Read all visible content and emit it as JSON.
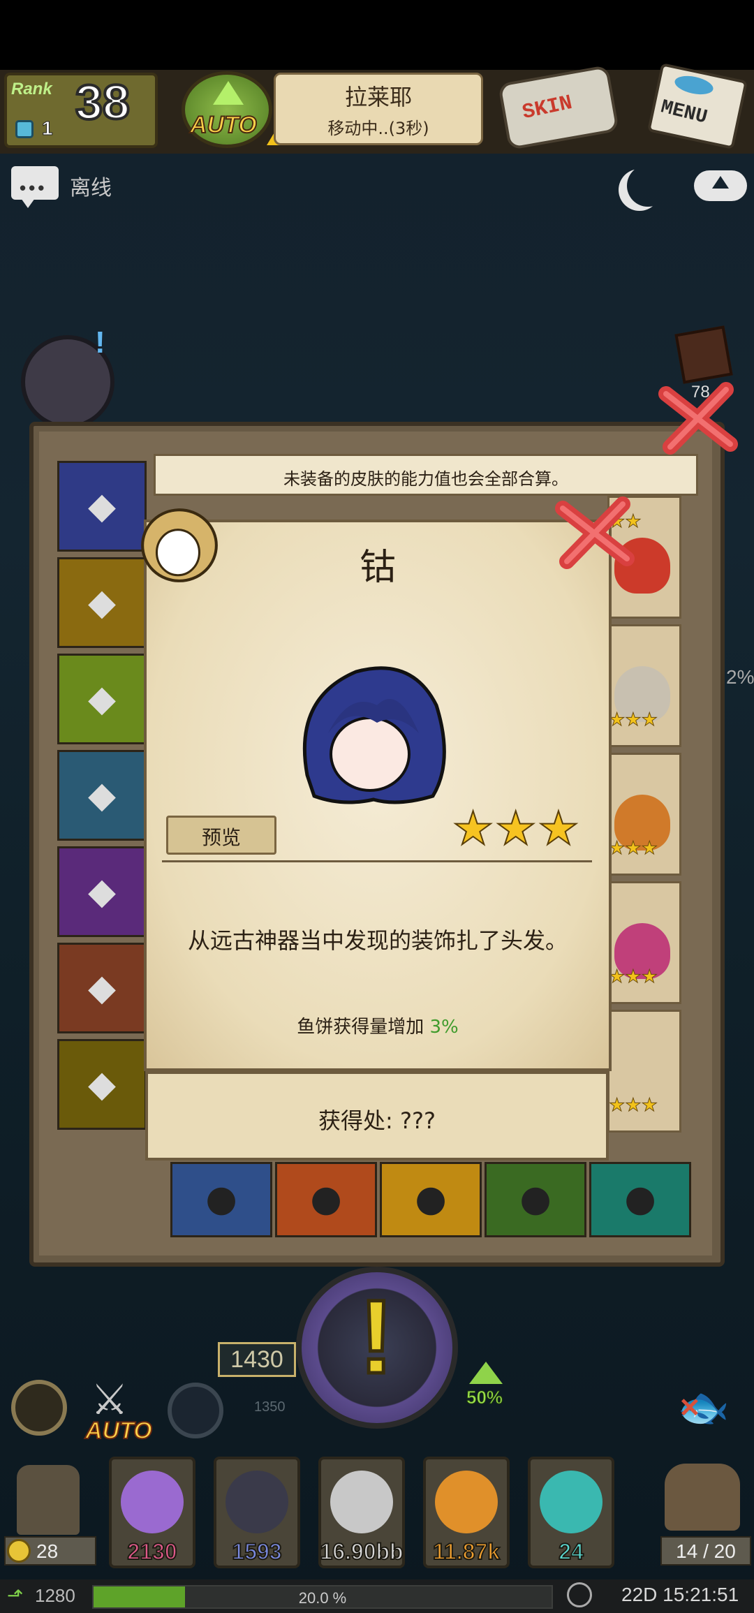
{
  "header": {
    "rank_label": "Rank",
    "rank_value": "38",
    "gems": "1",
    "auto_label": "AUTO",
    "location_name": "拉莱耶",
    "location_status": "移动中..(3秒)",
    "skin_label": "SKIN",
    "menu_label": "MENU"
  },
  "chat": {
    "dots": "•••",
    "status": "离线"
  },
  "side": {
    "badge": "78",
    "percent": "2%"
  },
  "panel": {
    "hint": "未装备的皮肤的能力值也会全部合算。",
    "tabs": [
      {
        "icon": "pistol-icon",
        "color": "#2f3a86"
      },
      {
        "icon": "top-hat-icon",
        "color": "#8a6a10"
      },
      {
        "icon": "hair-icon",
        "color": "#6a8a1c"
      },
      {
        "icon": "clothes-icon",
        "color": "#2a5a74"
      },
      {
        "icon": "ship-icon",
        "color": "#5a2a7a"
      },
      {
        "icon": "bag-icon",
        "color": "#7a3a22"
      },
      {
        "icon": "lantern-icon",
        "color": "#6a5a0a"
      }
    ],
    "slots": [
      {
        "icon": "cat-icon",
        "color": "#2f4f8a"
      },
      {
        "icon": "harpoon-icon",
        "color": "#b04a1c"
      },
      {
        "icon": "cannon-icon",
        "color": "#c08a12"
      },
      {
        "icon": "binoculars-icon",
        "color": "#3a6a22"
      },
      {
        "icon": "crystal-icon",
        "color": "#1a7a6a"
      }
    ],
    "right_cards": [
      {
        "stars": "★★",
        "hair_color": "#cc3a2a"
      },
      {
        "stars": "★★★",
        "hair_color": "#c8c0b0"
      },
      {
        "stars": "★★★",
        "hair_color": "#d07a2a"
      },
      {
        "stars": "★★★",
        "hair_color": "#c0407a"
      },
      {
        "stars": "★★★",
        "hair_color": ""
      }
    ]
  },
  "popup": {
    "title": "钴",
    "preview_label": "预览",
    "stars": "★★★",
    "description": "从远古神器当中发现的装饰扎了头发。",
    "bonus_label": "鱼饼获得量增加",
    "bonus_value": "3%",
    "source": "获得处:  ???",
    "hair_color": "#2e3a8e"
  },
  "hud": {
    "score": "1430",
    "small_score": "1350",
    "boost": "50%",
    "auto_label": "AUTO"
  },
  "resources": [
    {
      "icon": "pearl-icon",
      "value": "2130",
      "color": "#e05a8a",
      "ico_color": "#9a6ad0"
    },
    {
      "icon": "dark-gem-icon",
      "value": "1593",
      "color": "#7a8ae0",
      "ico_color": "#3a3a4a"
    },
    {
      "icon": "shell-icon",
      "value": "16.90bb",
      "color": "#d8d8d8",
      "ico_color": "#c8c8c8"
    },
    {
      "icon": "amber-icon",
      "value": "11.87k",
      "color": "#f0a030",
      "ico_color": "#e0902a"
    },
    {
      "icon": "diamond-icon",
      "value": "24",
      "color": "#5ad8d0",
      "ico_color": "#3ab8b0"
    }
  ],
  "lantern_count": "28",
  "bag_count": "14 / 20",
  "status": {
    "level": "1280",
    "xp_percent": "20.0 %",
    "xp_fraction": 0.2,
    "time": "22D 15:21:51"
  }
}
